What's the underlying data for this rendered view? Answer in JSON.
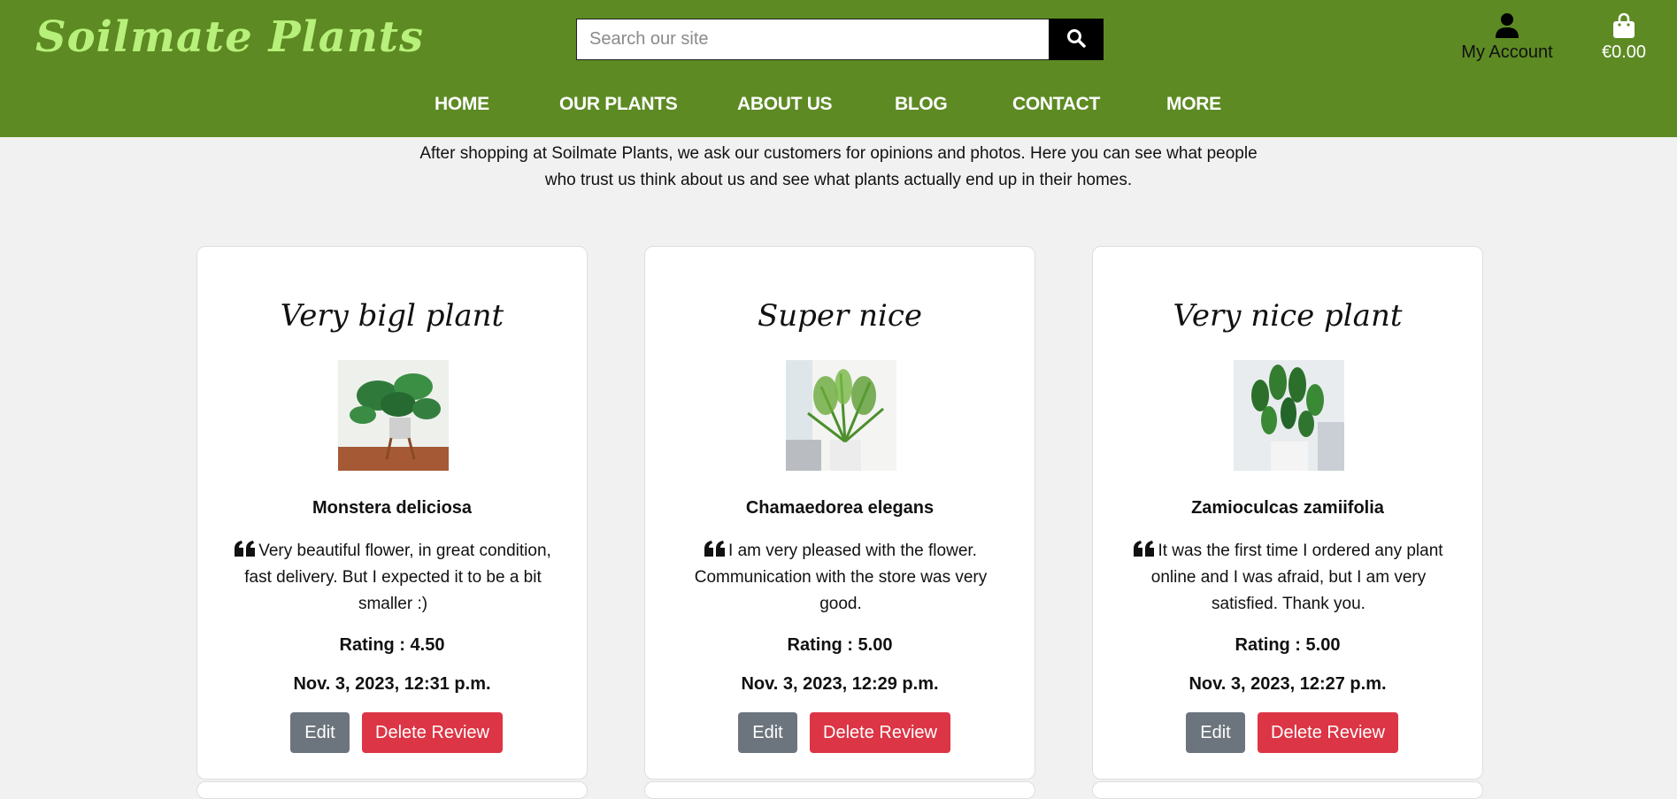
{
  "brand": {
    "name": "Soilmate Plants",
    "color": "#b7f07a"
  },
  "header": {
    "background": "#5d8a23",
    "search_placeholder": "Search our site",
    "account_label": "My Account",
    "cart_total": "€0.00"
  },
  "nav": {
    "items": [
      {
        "label": "HOME"
      },
      {
        "label": "OUR PLANTS"
      },
      {
        "label": "ABOUT US"
      },
      {
        "label": "BLOG"
      },
      {
        "label": "CONTACT"
      },
      {
        "label": "MORE"
      }
    ]
  },
  "intro": {
    "line1": "After shopping at Soilmate Plants, we ask our customers for opinions and photos. Here you can see what people",
    "line2": "who trust us think about us and see what plants actually end up in their homes."
  },
  "reviews": [
    {
      "title": "Very bigl plant",
      "plant": "Monstera deliciosa",
      "comment": "Very beautiful flower, in great condition, fast delivery. But I expected it to be a bit smaller :)",
      "rating": "Rating : 4.50",
      "date": "Nov. 3, 2023, 12:31 p.m.",
      "edit_label": "Edit",
      "delete_label": "Delete Review"
    },
    {
      "title": "Super nice",
      "plant": "Chamaedorea elegans",
      "comment": "I am very pleased with the flower. Communication with the store was very good.",
      "rating": "Rating : 5.00",
      "date": "Nov. 3, 2023, 12:29 p.m.",
      "edit_label": "Edit",
      "delete_label": "Delete Review"
    },
    {
      "title": "Very nice plant",
      "plant": "Zamioculcas zamiifolia",
      "comment": "It was the first time I ordered any plant online and I was afraid, but I am very satisfied. Thank you.",
      "rating": "Rating : 5.00",
      "date": "Nov. 3, 2023, 12:27 p.m.",
      "edit_label": "Edit",
      "delete_label": "Delete Review"
    }
  ],
  "icons": {
    "search": "search-icon",
    "account": "user-icon",
    "cart": "shopping-bag-icon",
    "quote": "quote-left-icon"
  },
  "button_colors": {
    "edit": "#6c757d",
    "delete": "#dc3545"
  }
}
